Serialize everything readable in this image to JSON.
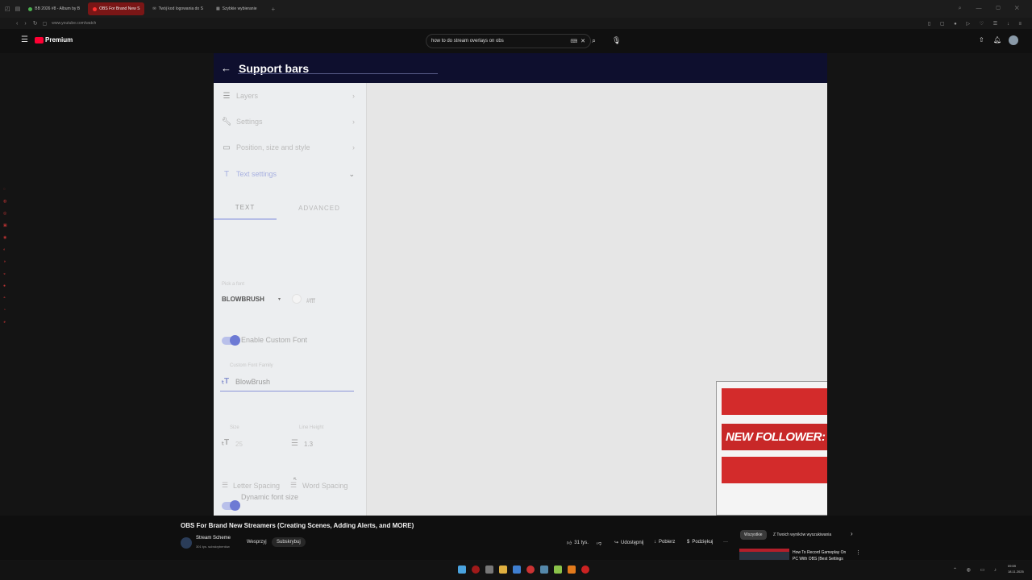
{
  "browser": {
    "tabs": [
      {
        "label": "BB 2026 #8 - Album by B"
      },
      {
        "label": "OBS For Brand New S"
      },
      {
        "label": "Twój kod logowania do S"
      },
      {
        "label": "Szybkie wybieranie"
      }
    ],
    "url": "www.youtube.com/watch"
  },
  "youtube": {
    "logo_label": "Premium",
    "search_query": "how to do stream overlays on obs",
    "video_title": "OBS For Brand New Streamers (Creating Scenes, Adding Alerts, and MORE)",
    "channel_name": "Stream Scheme",
    "subscribers": "301 tys. subskrybentów",
    "join_label": "Wesprzyj",
    "subscribe_label": "Subskrybuj",
    "likes": "31 tys.",
    "share_label": "Udostępnij",
    "download_label": "Pobierz",
    "thanks_label": "Podziękuj",
    "more_label": "···",
    "chips": [
      "Wszystkie",
      "Z Twoich wyników wyszukiwania"
    ],
    "next_video_title": "How To Record Gameplay On PC With OBS (Best Settings"
  },
  "video_ui": {
    "header_title": "Support bars",
    "menu": [
      {
        "label": "Layers",
        "icon": "layers-icon"
      },
      {
        "label": "Settings",
        "icon": "wrench-icon"
      },
      {
        "label": "Position, size and style",
        "icon": "position-icon"
      },
      {
        "label": "Text settings",
        "icon": "text-icon"
      }
    ],
    "tabs": [
      "TEXT",
      "ADVANCED"
    ],
    "pick_font_label": "Pick a font",
    "font_value": "BLOWBRUSH",
    "color_value": "#fff",
    "enable_custom_font_label": "Enable Custom Font",
    "custom_font_family_label": "Custom Font Family",
    "custom_font_family_value": "BlowBrush",
    "size_label": "Size",
    "size_value": "25",
    "line_height_label": "Line Height",
    "line_height_value": "1.3",
    "dynamic_font_label": "Dynamic font size",
    "letter_spacing_label": "Letter Spacing",
    "word_spacing_label": "Word Spacing",
    "preview_text": "NEW FOLLOWER: IT"
  },
  "taskbar": {
    "time": "09:59",
    "date": "18.11.2025"
  },
  "colors": {
    "header_navy": "#0e0f2e",
    "accent_blue": "#6d7ad4",
    "alert_red": "#d32b2b",
    "youtube_red": "#ff0033"
  }
}
